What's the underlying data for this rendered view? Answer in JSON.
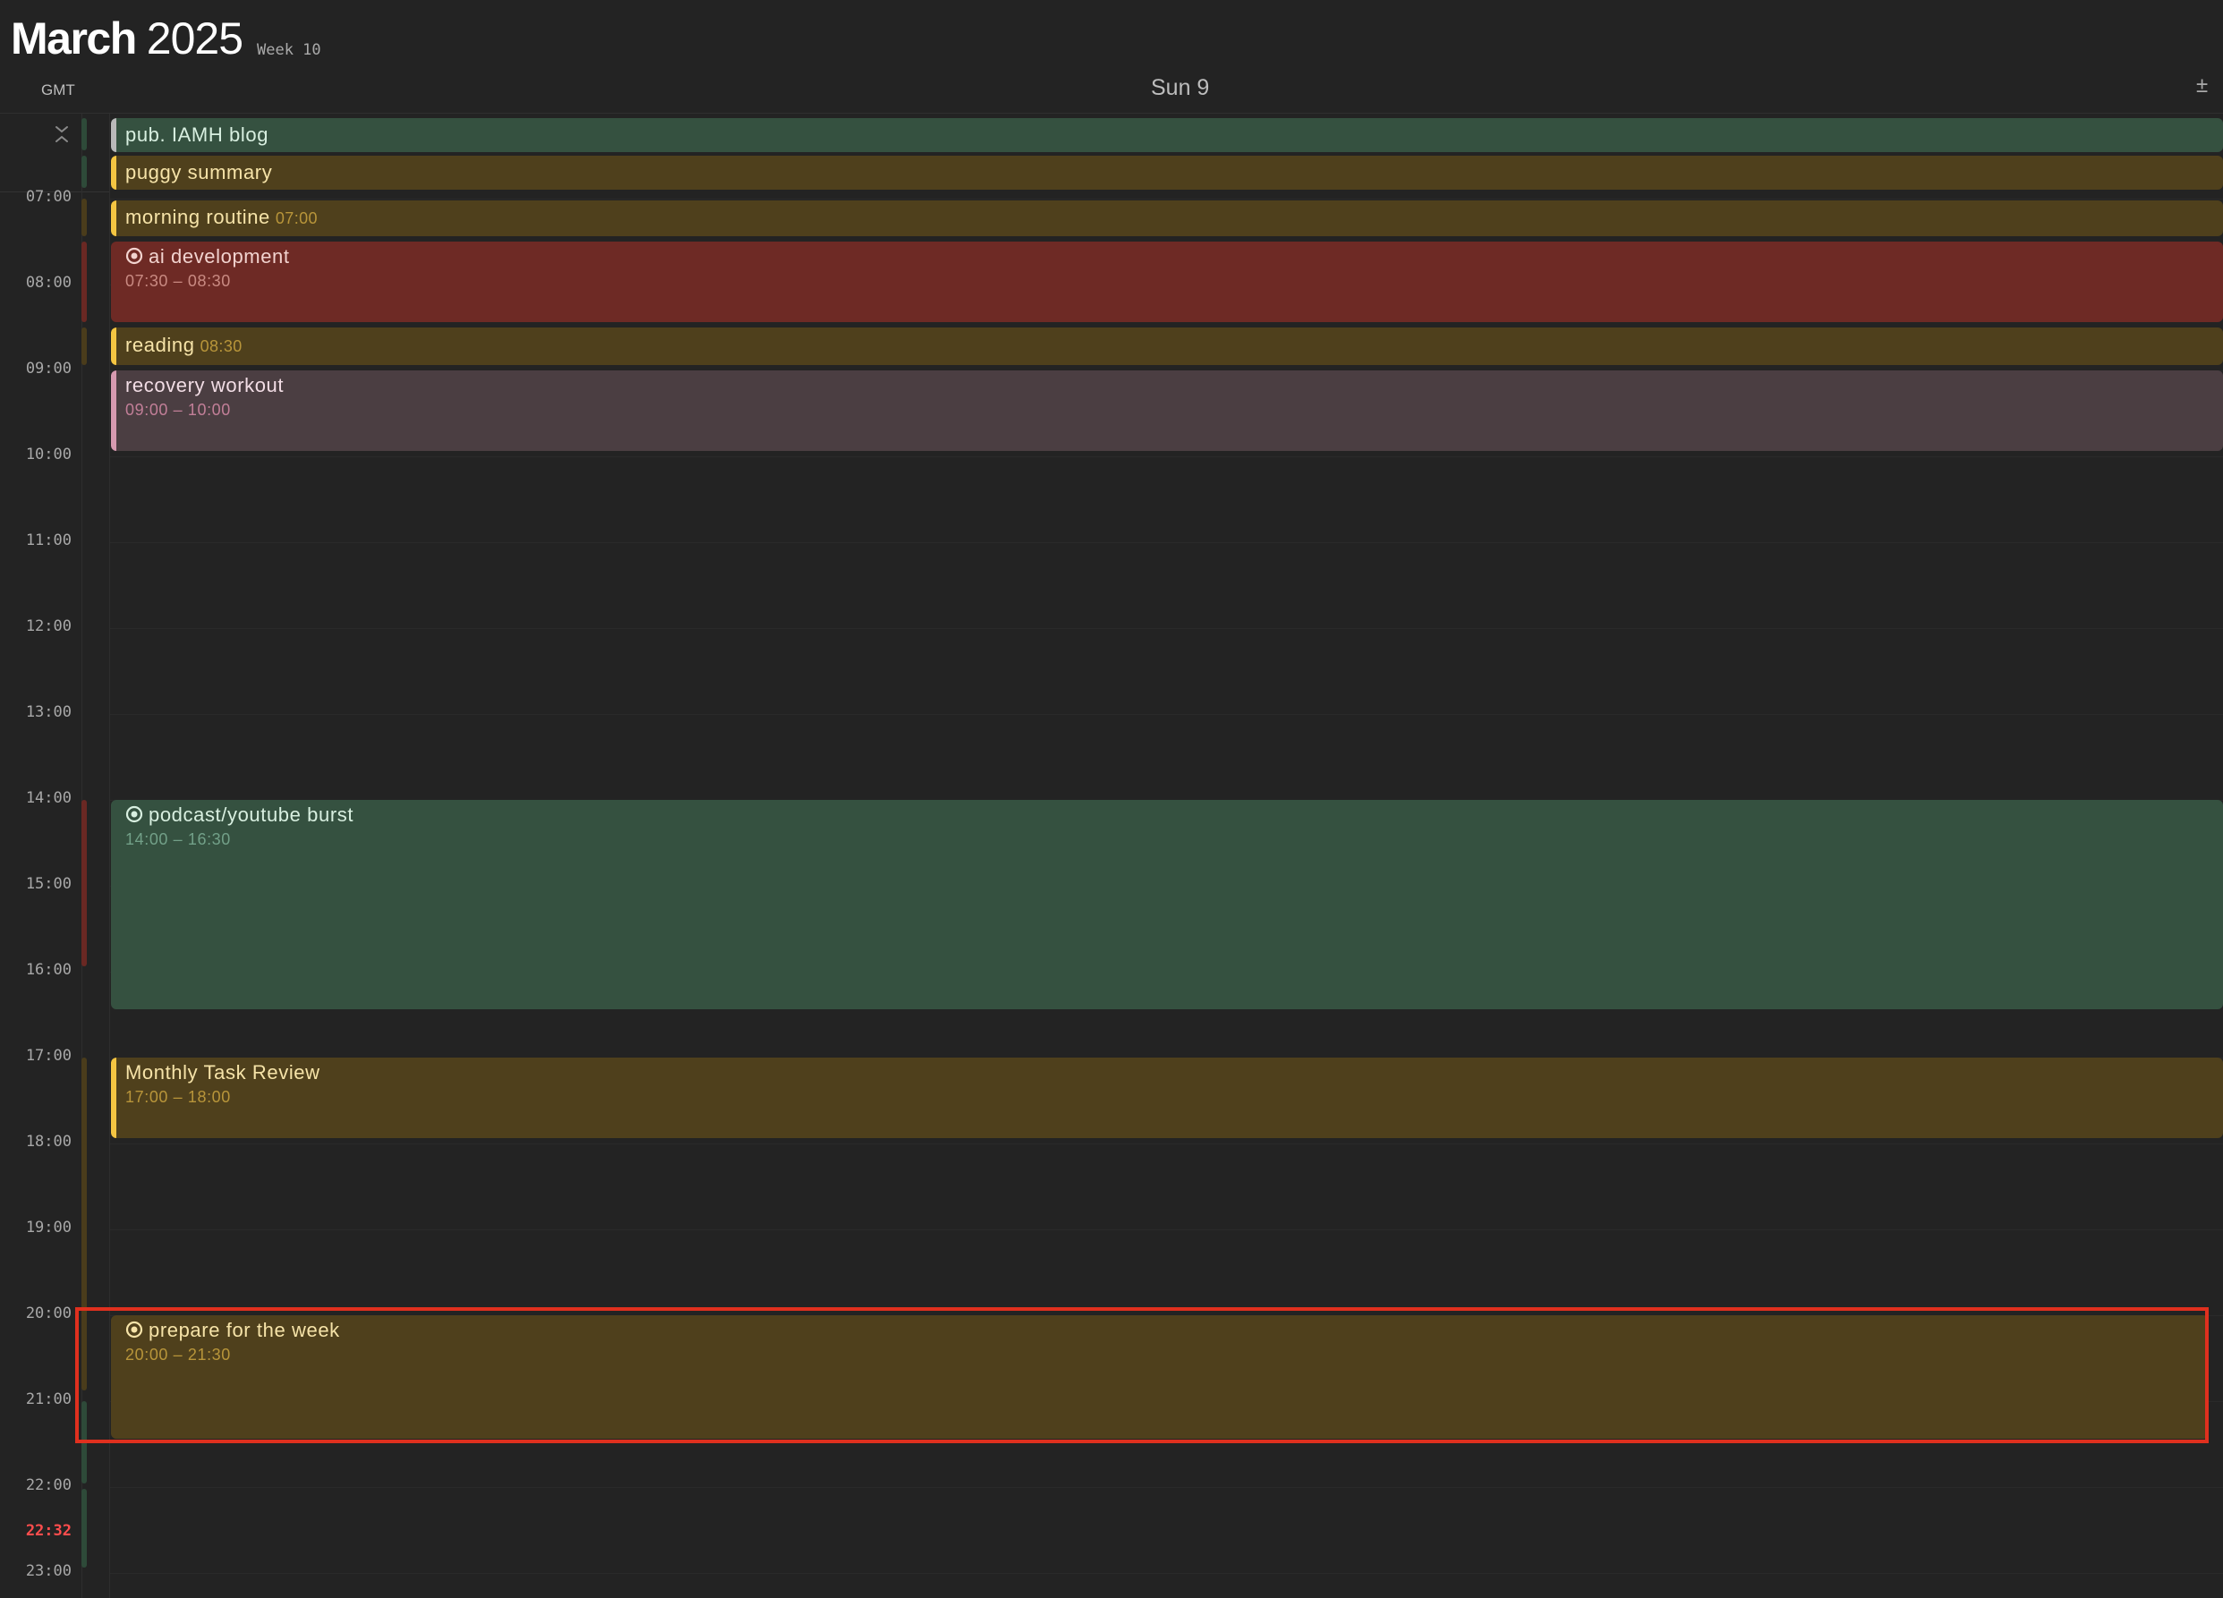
{
  "header": {
    "month": "March",
    "year": "2025",
    "week": "Week 10"
  },
  "timezone_label": "GMT",
  "day_label": "Sun 9",
  "zoom_label": "±",
  "hours": [
    "07:00",
    "08:00",
    "09:00",
    "10:00",
    "11:00",
    "12:00",
    "13:00",
    "14:00",
    "15:00",
    "16:00",
    "17:00",
    "18:00",
    "19:00",
    "20:00",
    "21:00",
    "22:00",
    "23:00"
  ],
  "now_label": "22:32",
  "all_day": [
    {
      "title": "pub. IAMH blog"
    },
    {
      "title": "puggy summary"
    }
  ],
  "events": [
    {
      "title": "morning routine",
      "time": "07:00"
    },
    {
      "title": "ai development",
      "time": "07:30 – 08:30"
    },
    {
      "title": "reading",
      "time": "08:30"
    },
    {
      "title": "recovery workout",
      "time": "09:00 – 10:00"
    },
    {
      "title": "podcast/youtube burst",
      "time": "14:00 – 16:30"
    },
    {
      "title": "Monthly Task Review",
      "time": "17:00 – 18:00"
    },
    {
      "title": "prepare for the week",
      "time": "20:00 – 21:30"
    }
  ],
  "colors": {
    "green": "#355140",
    "gold": "#4f401c",
    "red": "#6e2a25",
    "mauve": "#4b3e42",
    "now": "#ff4d4d",
    "highlight": "#e0301e"
  }
}
